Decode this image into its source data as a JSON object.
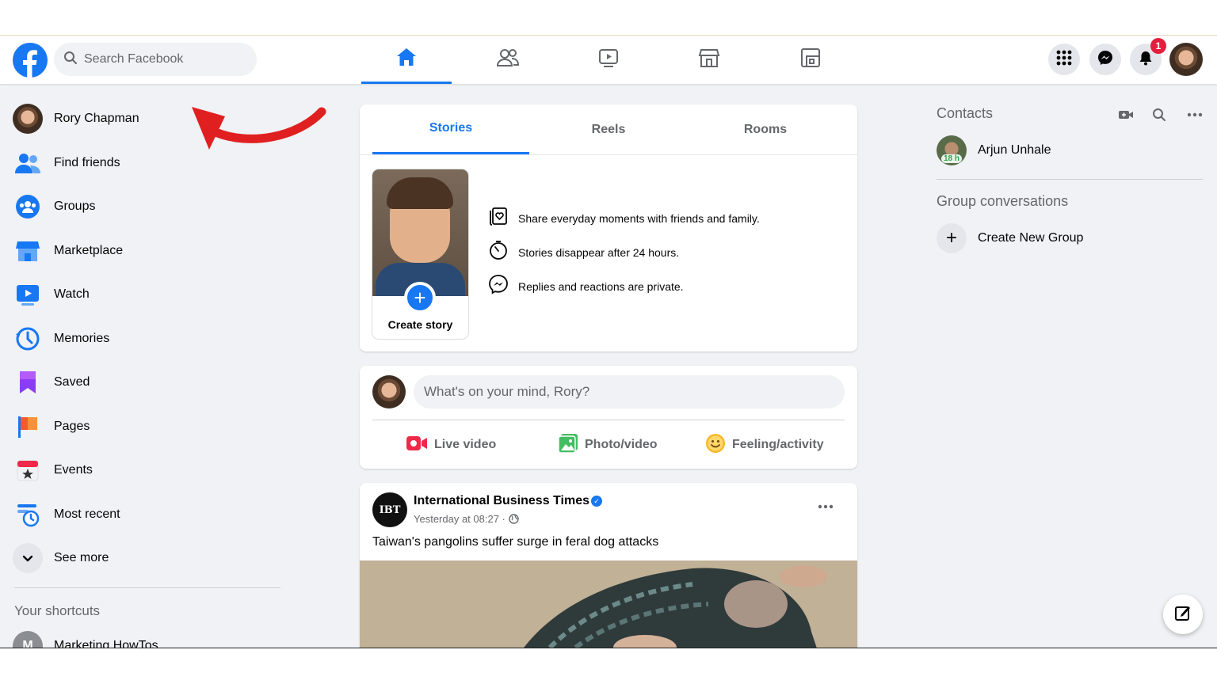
{
  "search": {
    "placeholder": "Search Facebook"
  },
  "notifications": {
    "count": "1"
  },
  "sidebar": {
    "items": [
      {
        "label": "Rory Chapman"
      },
      {
        "label": "Find friends"
      },
      {
        "label": "Groups"
      },
      {
        "label": "Marketplace"
      },
      {
        "label": "Watch"
      },
      {
        "label": "Memories"
      },
      {
        "label": "Saved"
      },
      {
        "label": "Pages"
      },
      {
        "label": "Events"
      },
      {
        "label": "Most recent"
      },
      {
        "label": "See more"
      }
    ],
    "shortcuts_title": "Your shortcuts",
    "shortcut": "Marketing HowTos"
  },
  "stories": {
    "tabs": [
      "Stories",
      "Reels",
      "Rooms"
    ],
    "create_label": "Create story",
    "info": [
      "Share everyday moments with friends and family.",
      "Stories disappear after 24 hours.",
      "Replies and reactions are private."
    ]
  },
  "composer": {
    "placeholder": "What's on your mind, Rory?",
    "live": "Live video",
    "photo": "Photo/video",
    "feeling": "Feeling/activity"
  },
  "post": {
    "avatar_text": "IBT",
    "author": "International Business Times",
    "time": "Yesterday at 08:27 ·",
    "text": "Taiwan's pangolins suffer surge in feral dog attacks"
  },
  "contacts": {
    "title": "Contacts",
    "name": "Arjun Unhale",
    "active_tag": "18 h",
    "groups_title": "Group conversations",
    "create_group": "Create New Group"
  },
  "colors": {
    "brand": "#1877f2",
    "badge": "#e41e3f",
    "arrow": "#e02020"
  }
}
